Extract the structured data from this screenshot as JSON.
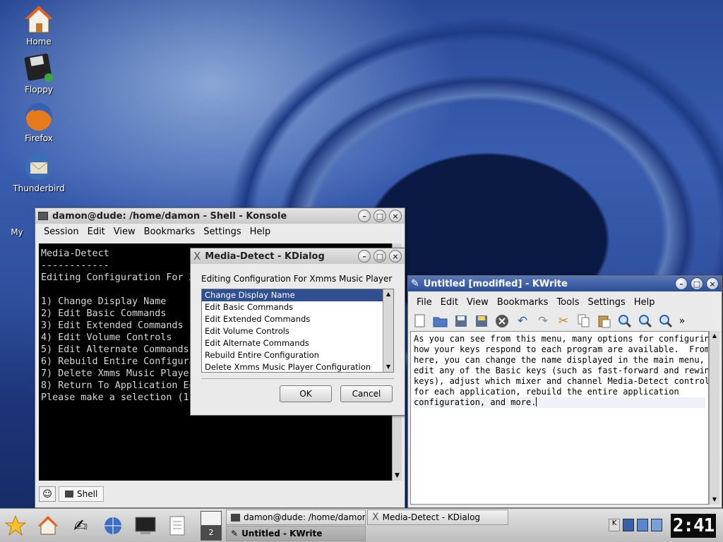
{
  "desktop": {
    "icons": [
      {
        "label": "Home"
      },
      {
        "label": "Floppy"
      },
      {
        "label": "Firefox"
      },
      {
        "label": "Thunderbird"
      },
      {
        "label": "My"
      }
    ]
  },
  "konsole": {
    "title": "damon@dude: /home/damon - Shell - Konsole",
    "menu": [
      "Session",
      "Edit",
      "View",
      "Bookmarks",
      "Settings",
      "Help"
    ],
    "terminal_text": "Media-Detect\n------------\nEditing Configuration For Xmms Music Player\n\n1) Change Display Name\n2) Edit Basic Commands\n3) Edit Extended Commands\n4) Edit Volume Controls\n5) Edit Alternate Commands\n6) Rebuild Entire Configuration\n7) Delete Xmms Music Player Configuration\n8) Return To Application Editor\nPlease make a selection (1-8): ",
    "tab_label": "Shell"
  },
  "kdialog": {
    "title": "Media-Detect - KDialog",
    "prompt": "Editing Configuration For Xmms Music Player",
    "items": [
      "Change Display Name",
      "Edit Basic Commands",
      "Edit Extended Commands",
      "Edit Volume Controls",
      "Edit Alternate Commands",
      "Rebuild Entire Configuration",
      "Delete Xmms Music Player Configuration"
    ],
    "selected_item": "Change Display Name",
    "ok_label": "OK",
    "cancel_label": "Cancel"
  },
  "kwrite": {
    "title": "Untitled [modified] - KWrite",
    "menu": [
      "File",
      "Edit",
      "View",
      "Bookmarks",
      "Tools",
      "Settings",
      "Help"
    ],
    "toolbar_icons": [
      "new-document-icon",
      "open-folder-icon",
      "save-icon",
      "save-as-icon",
      "close-document-icon",
      "undo-icon",
      "redo-icon",
      "cut-icon",
      "copy-icon",
      "paste-icon",
      "find-icon",
      "zoom-in-icon",
      "zoom-out-icon",
      "more-chevron-icon"
    ],
    "body_lines": [
      "As you can see from this menu, many options for configuring",
      "how your keys respond to each program are available.  From",
      "here, you can change the name displayed in the main menu,",
      "edit any of the Basic keys (such as fast-forward and rewind",
      "keys), adjust which mixer and channel Media-Detect controls",
      "for each application, rebuild the entire application",
      "configuration, and more."
    ]
  },
  "taskbar": {
    "pager_desktop": "2",
    "tasks": [
      {
        "label": "damon@dude: /home/damon - Shell - Konsole"
      },
      {
        "label": "Media-Detect - KDialog"
      },
      {
        "label": "Untitled - KWrite"
      }
    ],
    "clock": "2:41"
  },
  "colors": {
    "active_title": "#2a4d96",
    "selection": "#2f4f92",
    "terminal_bg": "#000000"
  }
}
